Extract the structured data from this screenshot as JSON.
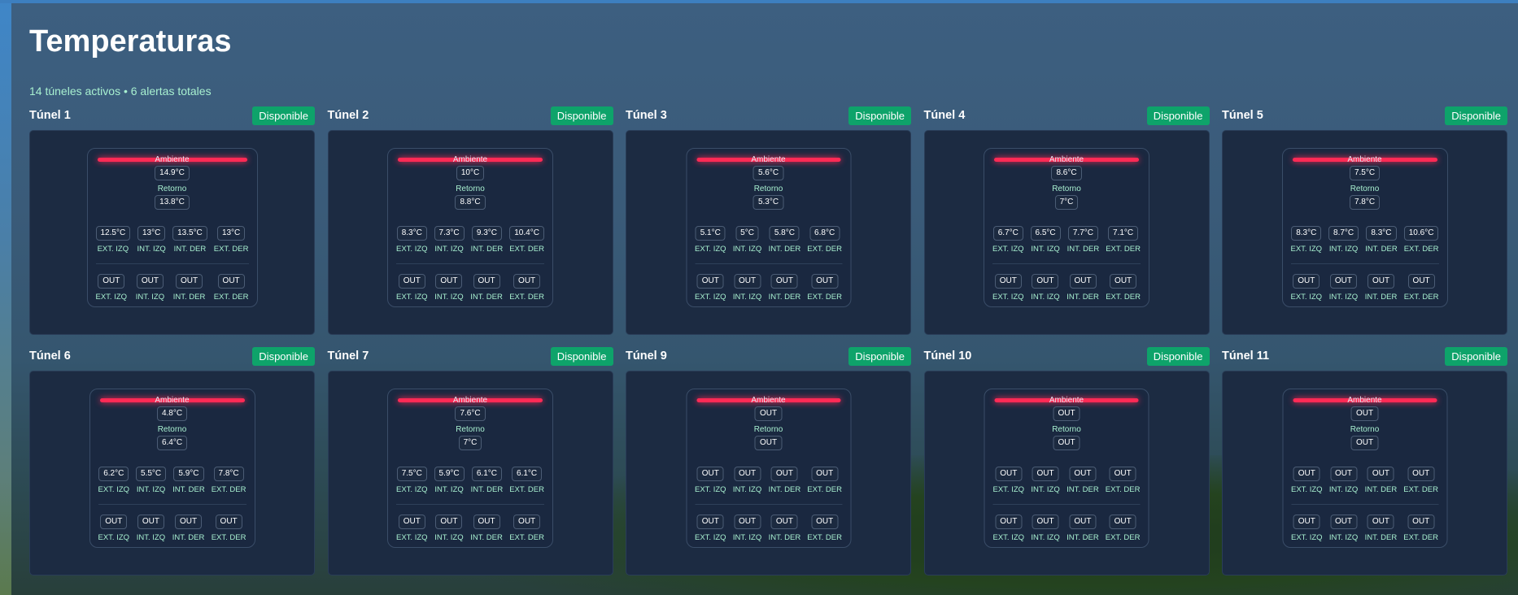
{
  "header": {
    "title": "Temperaturas",
    "subtitle": "14 túneles activos • 6 alertas totales"
  },
  "labels": {
    "ambiente": "Ambiente",
    "retorno": "Retorno",
    "sensors": [
      "EXT. IZQ",
      "INT. IZQ",
      "INT. DER",
      "EXT. DER"
    ]
  },
  "colors": {
    "badge": "#0ea36a",
    "glow": "#ff2a55",
    "accent_text": "#a8f0d0"
  },
  "tunnels": [
    {
      "name": "Túnel 1",
      "status": "Disponible",
      "ambiente": "14.9°C",
      "retorno": "13.8°C",
      "row1": [
        "12.5°C",
        "13°C",
        "13.5°C",
        "13°C"
      ],
      "row2": [
        "OUT",
        "OUT",
        "OUT",
        "OUT"
      ]
    },
    {
      "name": "Túnel 2",
      "status": "Disponible",
      "ambiente": "10°C",
      "retorno": "8.8°C",
      "row1": [
        "8.3°C",
        "7.3°C",
        "9.3°C",
        "10.4°C"
      ],
      "row2": [
        "OUT",
        "OUT",
        "OUT",
        "OUT"
      ]
    },
    {
      "name": "Túnel 3",
      "status": "Disponible",
      "ambiente": "5.6°C",
      "retorno": "5.3°C",
      "row1": [
        "5.1°C",
        "5°C",
        "5.8°C",
        "6.8°C"
      ],
      "row2": [
        "OUT",
        "OUT",
        "OUT",
        "OUT"
      ]
    },
    {
      "name": "Túnel 4",
      "status": "Disponible",
      "ambiente": "8.6°C",
      "retorno": "7°C",
      "row1": [
        "6.7°C",
        "6.5°C",
        "7.7°C",
        "7.1°C"
      ],
      "row2": [
        "OUT",
        "OUT",
        "OUT",
        "OUT"
      ]
    },
    {
      "name": "Túnel 5",
      "status": "Disponible",
      "ambiente": "7.5°C",
      "retorno": "7.8°C",
      "row1": [
        "8.3°C",
        "8.7°C",
        "8.3°C",
        "10.6°C"
      ],
      "row2": [
        "OUT",
        "OUT",
        "OUT",
        "OUT"
      ]
    },
    {
      "name": "Túnel 6",
      "status": "Disponible",
      "ambiente": "4.8°C",
      "retorno": "6.4°C",
      "row1": [
        "6.2°C",
        "5.5°C",
        "5.9°C",
        "7.8°C"
      ],
      "row2": [
        "OUT",
        "OUT",
        "OUT",
        "OUT"
      ]
    },
    {
      "name": "Túnel 7",
      "status": "Disponible",
      "ambiente": "7.6°C",
      "retorno": "7°C",
      "row1": [
        "7.5°C",
        "5.9°C",
        "6.1°C",
        "6.1°C"
      ],
      "row2": [
        "OUT",
        "OUT",
        "OUT",
        "OUT"
      ]
    },
    {
      "name": "Túnel 9",
      "status": "Disponible",
      "ambiente": "OUT",
      "retorno": "OUT",
      "row1": [
        "OUT",
        "OUT",
        "OUT",
        "OUT"
      ],
      "row2": [
        "OUT",
        "OUT",
        "OUT",
        "OUT"
      ]
    },
    {
      "name": "Túnel 10",
      "status": "Disponible",
      "ambiente": "OUT",
      "retorno": "OUT",
      "row1": [
        "OUT",
        "OUT",
        "OUT",
        "OUT"
      ],
      "row2": [
        "OUT",
        "OUT",
        "OUT",
        "OUT"
      ]
    },
    {
      "name": "Túnel 11",
      "status": "Disponible",
      "ambiente": "OUT",
      "retorno": "OUT",
      "row1": [
        "OUT",
        "OUT",
        "OUT",
        "OUT"
      ],
      "row2": [
        "OUT",
        "OUT",
        "OUT",
        "OUT"
      ]
    }
  ]
}
